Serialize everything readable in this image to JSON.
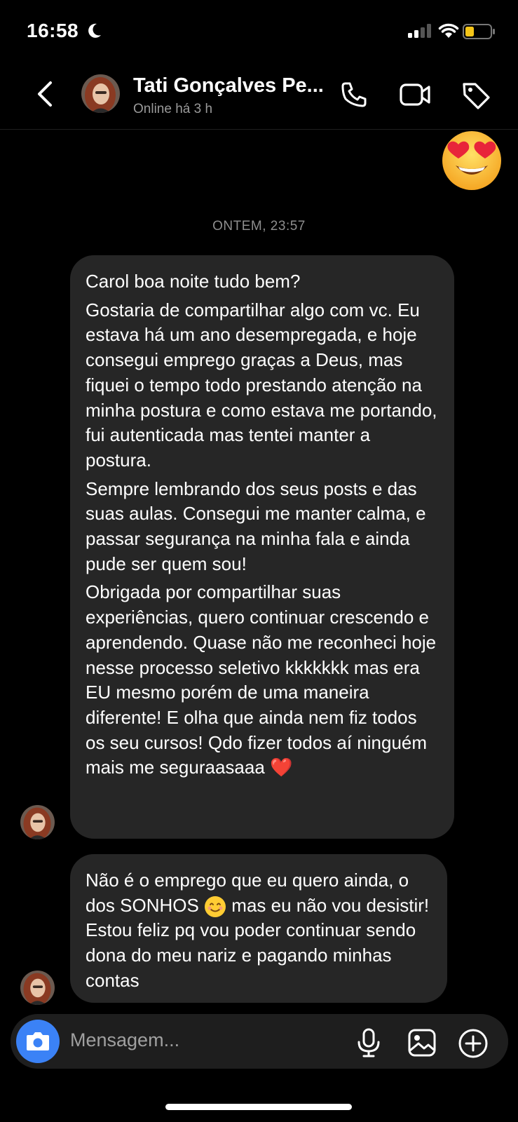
{
  "status_bar": {
    "time": "16:58"
  },
  "header": {
    "contact_name": "Tati Gonçalves Pe...",
    "presence": "Online há 3 h"
  },
  "thread": {
    "timestamp": "ONTEM, 23:57",
    "messages": [
      {
        "paragraphs": [
          "Carol boa noite tudo bem?",
          "Gostaria de compartilhar algo com vc. Eu estava há um ano desempregada, e hoje consegui emprego graças a Deus, mas fiquei o tempo todo prestando atenção na minha postura e como estava me portando, fui autenticada mas tentei manter a postura.",
          "Sempre lembrando dos seus posts e das suas aulas. Consegui me manter calma, e passar segurança na minha fala e ainda pude ser quem sou!",
          "Obrigada por compartilhar suas experiências, quero continuar crescendo e aprendendo. Quase não me reconheci hoje nesse processo seletivo kkkkkkk mas era EU mesmo porém de uma maneira diferente! E olha que ainda nem fiz todos os seu cursos! Qdo fizer todos aí ninguém mais me seguraasaaa ❤️"
        ]
      },
      {
        "text_part1": "Não é o emprego que eu quero ainda, o dos SONHOS ",
        "emoji": "smiling-face",
        "text_part2": " mas eu não vou desistir! Estou feliz pq vou poder continuar sendo dona do meu nariz e pagando minhas contas"
      }
    ],
    "reaction_emoji": "heart-eyes-emoji"
  },
  "composer": {
    "placeholder": "Mensagem..."
  },
  "colors": {
    "bubble": "#262626",
    "camera_button": "#3b82f6",
    "battery_level": "#f5c518"
  }
}
